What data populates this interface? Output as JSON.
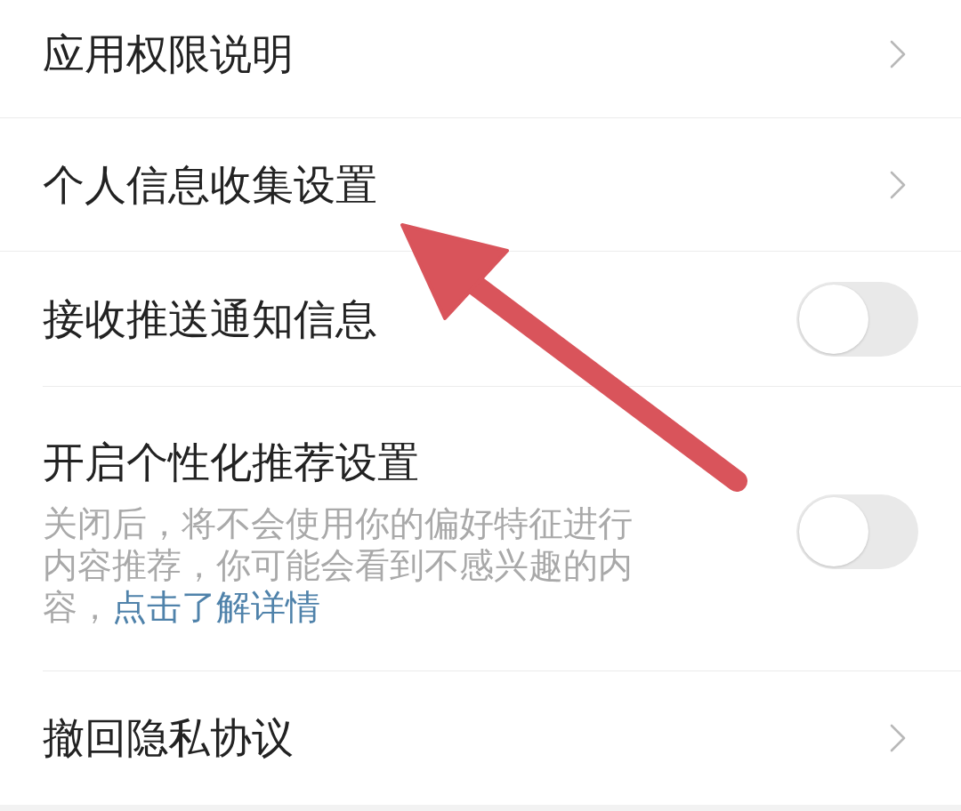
{
  "rows": [
    {
      "kind": "link",
      "label": "应用权限说明"
    },
    {
      "kind": "link",
      "label": "个人信息收集设置"
    },
    {
      "kind": "toggle",
      "label": "接收推送通知信息",
      "on": false
    },
    {
      "kind": "toggle",
      "label": "开启个性化推荐设置",
      "description": "关闭后，将不会使用你的偏好特征进行内容推荐，你可能会看到不感兴趣的内容，",
      "link": "点击了解详情",
      "on": false
    },
    {
      "kind": "link",
      "label": "撤回隐私协议"
    }
  ]
}
